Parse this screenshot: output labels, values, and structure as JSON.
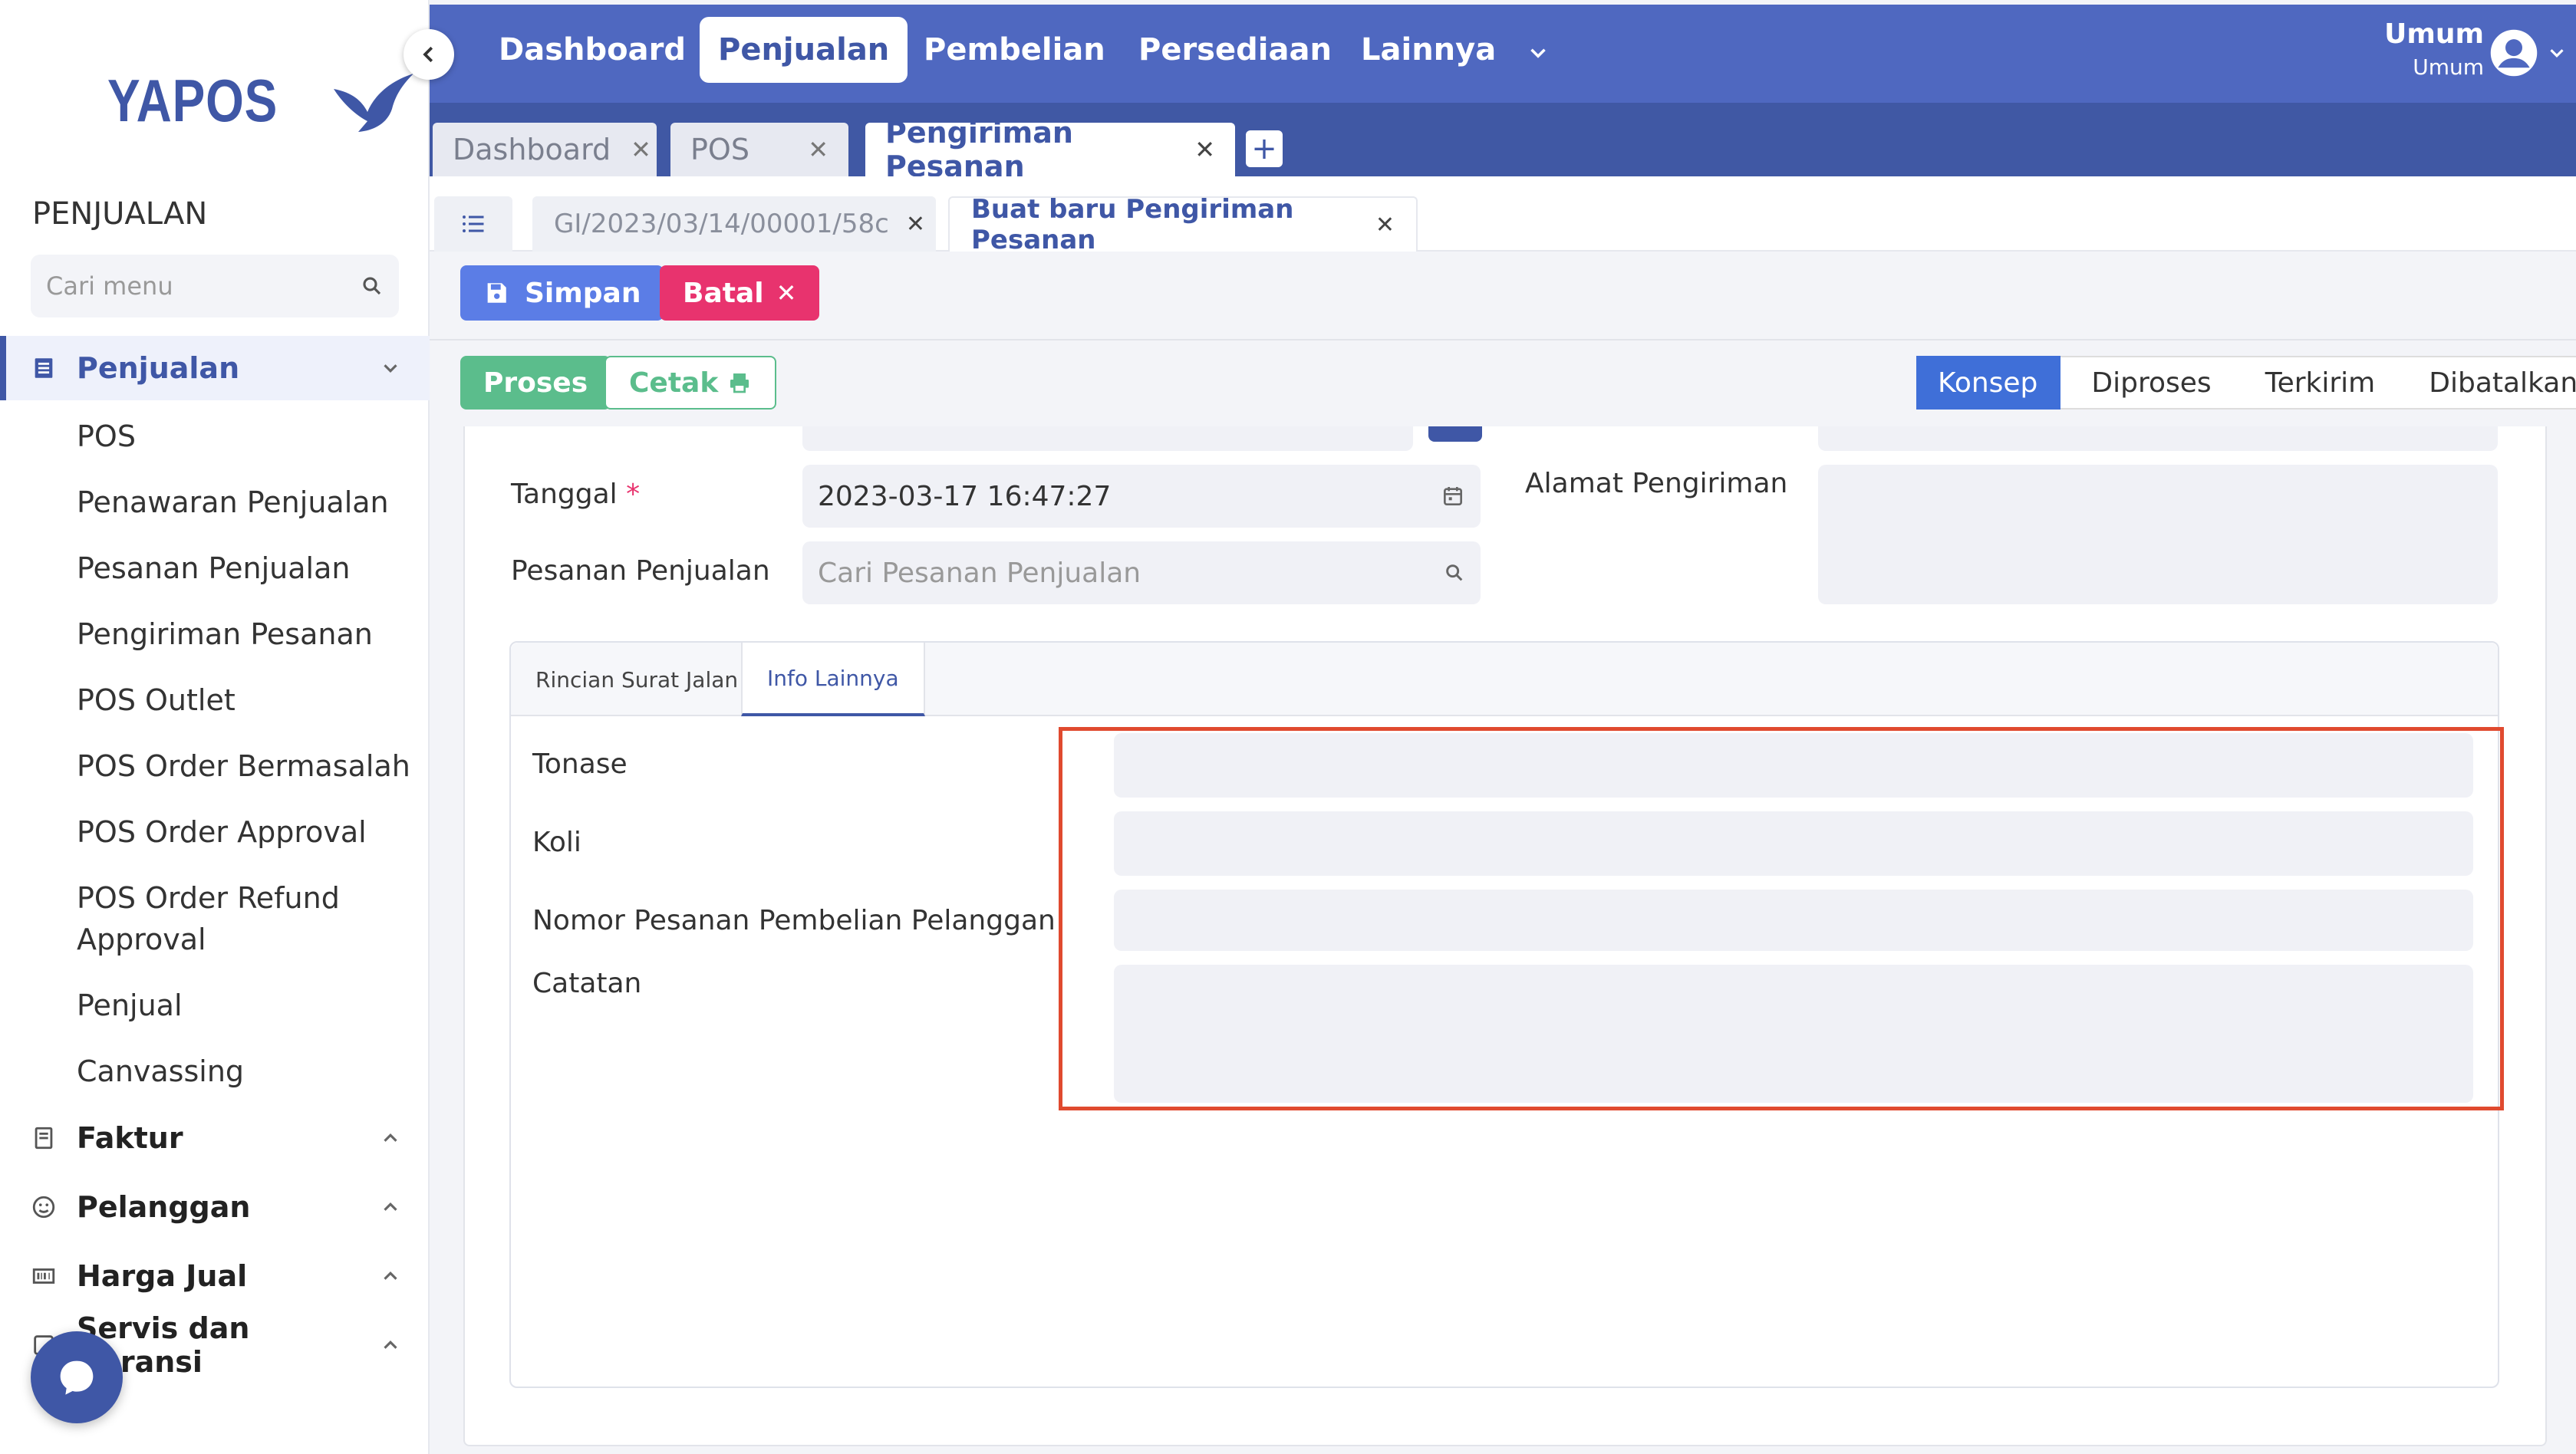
{
  "brand": {
    "name": "YAPOS"
  },
  "sidebar": {
    "section_title": "PENJUALAN",
    "search_placeholder": "Cari menu",
    "groups": [
      {
        "label": "Penjualan",
        "icon": "receipt-icon",
        "expanded": true,
        "items": [
          "POS",
          "Penawaran Penjualan",
          "Pesanan Penjualan",
          "Pengiriman Pesanan",
          "POS Outlet",
          "POS Order Bermasalah",
          "POS Order Approval",
          "POS Order Refund Approval",
          "Penjual",
          "Canvassing"
        ]
      },
      {
        "label": "Faktur",
        "icon": "invoice-icon"
      },
      {
        "label": "Pelanggan",
        "icon": "customer-icon"
      },
      {
        "label": "Harga Jual",
        "icon": "barcode-icon"
      },
      {
        "label": "Servis dan Garansi",
        "icon": "service-icon"
      }
    ]
  },
  "topnav": {
    "items": [
      "Dashboard",
      "Penjualan",
      "Pembelian",
      "Persediaan",
      "Lainnya"
    ],
    "active": "Penjualan",
    "user": {
      "name": "Umum",
      "sub": "Umum"
    }
  },
  "app_tabs": [
    {
      "label": "Dashboard",
      "active": false
    },
    {
      "label": "POS",
      "active": false
    },
    {
      "label": "Pengiriman Pesanan",
      "active": true
    }
  ],
  "sub_tabs": [
    {
      "label": "GI/2023/03/14/00001/58c",
      "active": false
    },
    {
      "label": "Buat baru Pengiriman Pesanan",
      "active": true
    }
  ],
  "actions": {
    "save": "Simpan",
    "cancel": "Batal",
    "process": "Proses",
    "print": "Cetak"
  },
  "status_steps": [
    "Konsep",
    "Diproses",
    "Terkirim",
    "Dibatalkan"
  ],
  "status_active": "Konsep",
  "form": {
    "tanggal_label": "Tanggal",
    "tanggal_value": "2023-03-17  16:47:27",
    "pesanan_label": "Pesanan Penjualan",
    "pesanan_placeholder": "Cari Pesanan Penjualan",
    "alamat_label": "Alamat Pengiriman"
  },
  "inner_tabs": [
    "Rincian Surat Jalan",
    "Info Lainnya"
  ],
  "inner_tab_active": "Info Lainnya",
  "info_lainnya": {
    "tonase_label": "Tonase",
    "koli_label": "Koli",
    "po_label": "Nomor Pesanan Pembelian Pelanggan",
    "catatan_label": "Catatan"
  },
  "colors": {
    "primary": "#4f68c0",
    "accent": "#3f57a6",
    "danger": "#e8336e",
    "success": "#5bbd8c",
    "highlight": "#e04a2f"
  }
}
